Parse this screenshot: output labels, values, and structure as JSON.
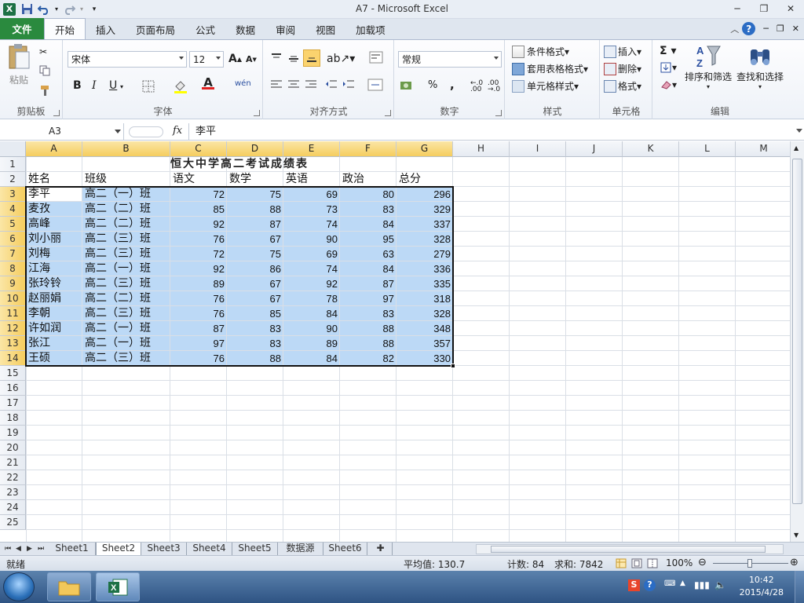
{
  "window": {
    "title": "A7  -  Microsoft Excel",
    "qat": {
      "save": "save-icon",
      "undo": "undo-icon",
      "redo": "redo-icon",
      "customize": "customize-qat-icon"
    },
    "controls": {
      "minimize": "─",
      "restore": "❐",
      "close": "✕"
    }
  },
  "ribbon_tabs": [
    {
      "label": "文件"
    },
    {
      "label": "开始"
    },
    {
      "label": "插入"
    },
    {
      "label": "页面布局"
    },
    {
      "label": "公式"
    },
    {
      "label": "数据"
    },
    {
      "label": "审阅"
    },
    {
      "label": "视图"
    },
    {
      "label": "加载项"
    }
  ],
  "ribbon": {
    "clipboard": {
      "label": "剪贴板",
      "paste": "粘贴"
    },
    "font": {
      "label": "字体",
      "family": "宋体",
      "size": "12",
      "bold": "B",
      "italic": "I",
      "underline": "U",
      "grow": "A",
      "shrink": "A",
      "color_letter": "A",
      "phonetic": "wén"
    },
    "alignment": {
      "label": "对齐方式"
    },
    "number": {
      "label": "数字",
      "format": "常规",
      "percent": "%",
      "comma": ",",
      "inc": "←.0 .00",
      "dec": ".00 →.0"
    },
    "styles": {
      "label": "样式",
      "conditional": "条件格式",
      "table": "套用表格格式",
      "cell_styles": "单元格样式"
    },
    "cells": {
      "label": "单元格",
      "insert": "插入",
      "delete": "删除",
      "format": "格式"
    },
    "editing": {
      "label": "编辑",
      "sort": "排序和筛选",
      "find": "查找和选择"
    }
  },
  "formula_bar": {
    "name_box": "A3",
    "fx": "fx",
    "value": "李平"
  },
  "columns": [
    "A",
    "B",
    "C",
    "D",
    "E",
    "F",
    "G",
    "H",
    "I",
    "J",
    "K",
    "L",
    "M"
  ],
  "rows": [
    "1",
    "2",
    "3",
    "4",
    "5",
    "6",
    "7",
    "8",
    "9",
    "10",
    "11",
    "12",
    "13",
    "14",
    "15",
    "16",
    "17",
    "18",
    "19",
    "20",
    "21",
    "22",
    "23",
    "24",
    "25"
  ],
  "sheet": {
    "title": "恒大中学高二考试成绩表",
    "headers": [
      "姓名",
      "班级",
      "语文",
      "数学",
      "英语",
      "政治",
      "总分"
    ],
    "records": [
      [
        "李平",
        "高二（一）班",
        "72",
        "75",
        "69",
        "80",
        "296"
      ],
      [
        "麦孜",
        "高二（二）班",
        "85",
        "88",
        "73",
        "83",
        "329"
      ],
      [
        "高峰",
        "高二（二）班",
        "92",
        "87",
        "74",
        "84",
        "337"
      ],
      [
        "刘小丽",
        "高二（三）班",
        "76",
        "67",
        "90",
        "95",
        "328"
      ],
      [
        "刘梅",
        "高二（三）班",
        "72",
        "75",
        "69",
        "63",
        "279"
      ],
      [
        "江海",
        "高二（一）班",
        "92",
        "86",
        "74",
        "84",
        "336"
      ],
      [
        "张玲铃",
        "高二（三）班",
        "89",
        "67",
        "92",
        "87",
        "335"
      ],
      [
        "赵丽娟",
        "高二（二）班",
        "76",
        "67",
        "78",
        "97",
        "318"
      ],
      [
        "李朝",
        "高二（三）班",
        "76",
        "85",
        "84",
        "83",
        "328"
      ],
      [
        "许如润",
        "高二（一）班",
        "87",
        "83",
        "90",
        "88",
        "348"
      ],
      [
        "张江",
        "高二（一）班",
        "97",
        "83",
        "89",
        "88",
        "357"
      ],
      [
        "王硕",
        "高二（三）班",
        "76",
        "88",
        "84",
        "82",
        "330"
      ]
    ]
  },
  "sheet_tabs": [
    "Sheet1",
    "Sheet2",
    "Sheet3",
    "Sheet4",
    "Sheet5",
    "数据源",
    "Sheet6"
  ],
  "active_sheet": "Sheet2",
  "status": {
    "mode": "就绪",
    "average": "平均值: 130.7",
    "count": "计数: 84",
    "sum": "求和: 7842",
    "zoom": "100%"
  },
  "taskbar": {
    "time": "10:42",
    "date": "2015/4/28"
  },
  "colors": {
    "selection": "#bcd9f6",
    "header_selected": "#f5cd5e",
    "file_tab": "#2a8a3e",
    "accent": "#2b6cc4"
  }
}
